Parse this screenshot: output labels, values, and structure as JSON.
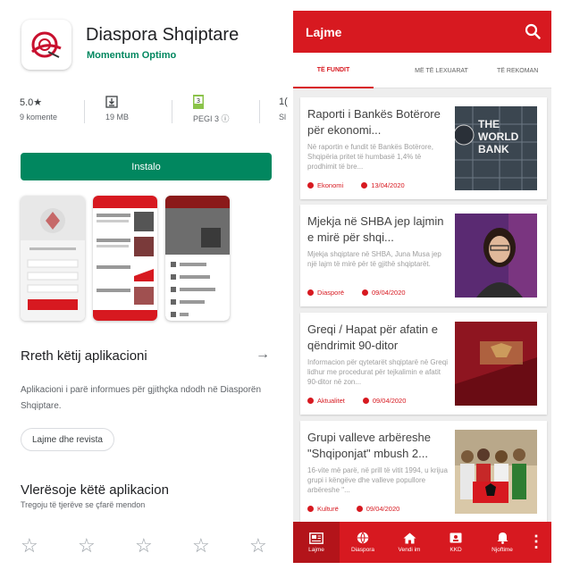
{
  "store": {
    "app_name": "Diaspora Shqiptare",
    "developer": "Momentum Optimo",
    "stats": [
      {
        "value": "5.0★",
        "label": "9 komente"
      },
      {
        "value": "19 MB",
        "label": ""
      },
      {
        "value": "PEGI 3 ⓘ",
        "label": ""
      },
      {
        "value": "1(",
        "label": "Sl"
      }
    ],
    "install_label": "Instalo",
    "about_title": "Rreth këtij aplikacioni",
    "about_desc": "Aplikacioni i parë informues për gjithçka ndodh në Diasporën Shqiptare.",
    "category_chip": "Lajme dhe revista",
    "rate_title": "Vlerësoje këtë aplikacion",
    "rate_sub": "Tregoju të tjerëve se çfarë mendon",
    "star_glyph": "☆"
  },
  "news": {
    "title": "Lajme",
    "tabs": [
      "TË FUNDIT",
      "MË TË LEXUARAT",
      "TË REKOMAN"
    ],
    "articles": [
      {
        "title": "Raporti i Bankës Botërore për ekonomi...",
        "summary": "Në raportin e fundit të Bankës Botërore, Shqipëria pritet të humbasë 1,4% të prodhimit të bre...",
        "category": "Ekonomi",
        "date": "13/04/2020",
        "thumb_text": "THE WORLD BANK"
      },
      {
        "title": "Mjekja në SHBA jep lajmin e mirë për shqi...",
        "summary": "Mjekja shqiptare në SHBA, Juna Musa jep një lajm të mirë për të gjithë shqiptarët.",
        "category": "Diasporë",
        "date": "09/04/2020",
        "thumb_text": ""
      },
      {
        "title": "Greqi / Hapat për afatin e qëndrimit 90-ditor",
        "summary": "Informacion për qytetarët shqiptarë në Greqi lidhur me procedurat për tejkalimin e afatit 90-ditor në zon...",
        "category": "Aktualitet",
        "date": "09/04/2020",
        "thumb_text": ""
      },
      {
        "title": "Grupi valleve arbëreshe \"Shqiponjat\" mbush 2...",
        "summary": "16-vite më parë, në prill të vitit 1994, u krijua grupi i këngëve dhe valleve popullore arbëreshe \"...",
        "category": "Kulturë",
        "date": "09/04/2020",
        "thumb_text": ""
      }
    ],
    "nav": [
      "Lajme",
      "Diaspora",
      "Vendi im",
      "KKD",
      "Njoftime"
    ],
    "more_glyph": "⋮",
    "colors": {
      "primary": "#d71920",
      "install": "#01875f"
    }
  }
}
